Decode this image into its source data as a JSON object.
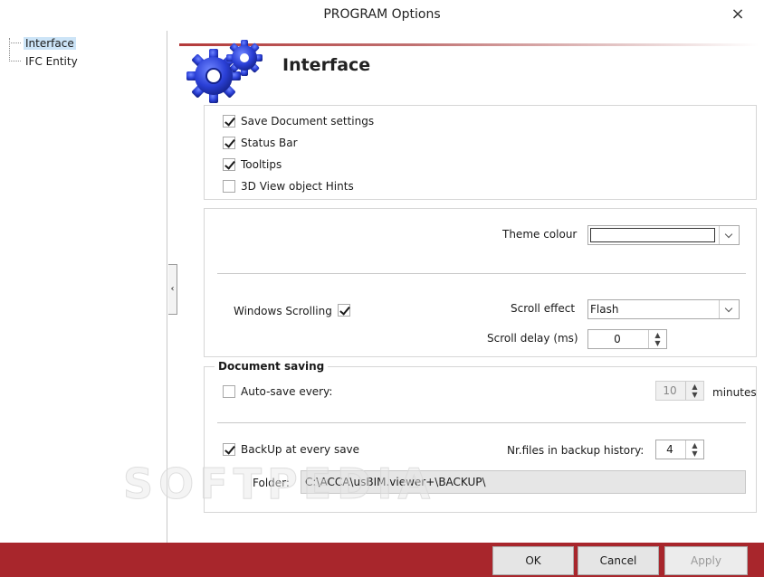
{
  "window": {
    "title": "PROGRAM Options",
    "close_icon": "×"
  },
  "tree": {
    "items": [
      {
        "label": "Interface",
        "selected": true
      },
      {
        "label": "IFC Entity",
        "selected": false
      }
    ]
  },
  "splitter": {
    "arrow": "‹"
  },
  "page": {
    "title": "Interface",
    "icon": "gears-icon"
  },
  "general": {
    "checkboxes": [
      {
        "label": "Save Document settings",
        "checked": true
      },
      {
        "label": "Status Bar",
        "checked": true
      },
      {
        "label": "Tooltips",
        "checked": true
      },
      {
        "label": "3D View object Hints",
        "checked": false
      }
    ]
  },
  "display": {
    "theme_colour_label": "Theme colour",
    "theme_colour_value": "#ffffff",
    "windows_scrolling_label": "Windows Scrolling",
    "windows_scrolling_checked": true,
    "scroll_effect_label": "Scroll effect",
    "scroll_effect_value": "Flash",
    "scroll_delay_label": "Scroll delay (ms)",
    "scroll_delay_value": "0"
  },
  "saving": {
    "legend": "Document saving",
    "autosave_label": "Auto-save every:",
    "autosave_checked": false,
    "autosave_value": "10",
    "minutes_label": "minutes",
    "backup_label": "BackUp at every save",
    "backup_checked": true,
    "nr_files_label": "Nr.files in backup history:",
    "nr_files_value": "4",
    "folder_label": "Folder:",
    "folder_value": "C:\\ACCA\\usBIM.viewer+\\BACKUP\\"
  },
  "watermark": "SOFTPEDIA",
  "buttons": {
    "ok": "OK",
    "cancel": "Cancel",
    "apply": "Apply"
  },
  "colors": {
    "accent": "#a8262c",
    "selection": "#cce4f7",
    "gear": "#2a3fd6"
  }
}
